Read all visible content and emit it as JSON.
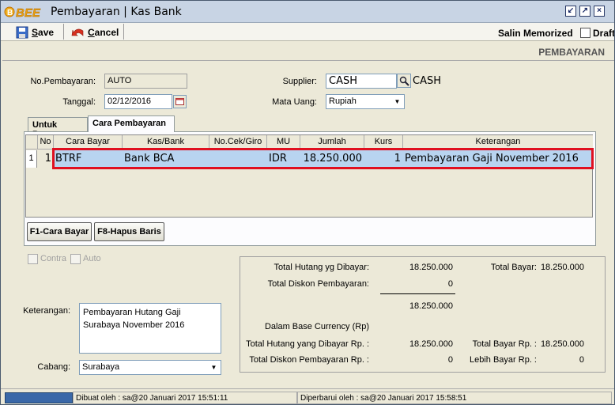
{
  "window": {
    "title": "Pembayaran | Kas Bank",
    "logo_text": "BEE"
  },
  "toolbar": {
    "save_label": "Save",
    "cancel_label": "Cancel",
    "memorized_label": "Salin Memorized",
    "draft_label": "Draft"
  },
  "header": {
    "heading": "PEMBAYARAN"
  },
  "form": {
    "no_pembayaran_label": "No.Pembayaran:",
    "no_pembayaran_value": "AUTO",
    "tanggal_label": "Tanggal:",
    "tanggal_value": "02/12/2016",
    "supplier_label": "Supplier:",
    "supplier_value": "CASH",
    "supplier_name": "CASH",
    "mata_uang_label": "Mata Uang:",
    "mata_uang_value": "Rupiah"
  },
  "tabs": [
    {
      "label": "Untuk Bayar"
    },
    {
      "label": "Cara Pembayaran"
    }
  ],
  "grid": {
    "columns": [
      "No",
      "Cara Bayar",
      "Kas/Bank",
      "No.Cek/Giro",
      "MU",
      "Jumlah",
      "Kurs",
      "Keterangan"
    ],
    "rows": [
      {
        "row_index": "1",
        "no": "1",
        "cara_bayar": "BTRF",
        "kas_bank": "Bank BCA",
        "no_cek": "",
        "mu": "IDR",
        "jumlah": "18.250.000",
        "kurs": "1",
        "keterangan": "Pembayaran Gaji November 2016"
      }
    ]
  },
  "buttons": {
    "cara_bayar": "F1-Cara Bayar",
    "hapus_baris": "F8-Hapus Baris"
  },
  "options": {
    "contra": "Contra",
    "auto": "Auto"
  },
  "notes": {
    "keterangan_label": "Keterangan:",
    "keterangan_line1": "Pembayaran Hutang Gaji",
    "keterangan_line2": "Surabaya November 2016",
    "cabang_label": "Cabang:",
    "cabang_value": "Surabaya"
  },
  "summary": {
    "total_hutang_label": "Total Hutang yg Dibayar:",
    "total_hutang_value": "18.250.000",
    "total_bayar_label": "Total Bayar:",
    "total_bayar_value": "18.250.000",
    "total_diskon_label": "Total Diskon Pembayaran:",
    "total_diskon_value": "0",
    "subtotal_value": "18.250.000",
    "base_currency_label": "Dalam Base Currency (Rp)",
    "total_hutang_rp_label": "Total Hutang yang Dibayar Rp. :",
    "total_hutang_rp_value": "18.250.000",
    "total_bayar_rp_label": "Total Bayar Rp. :",
    "total_bayar_rp_value": "18.250.000",
    "total_diskon_rp_label": "Total Diskon Pembayaran Rp. :",
    "total_diskon_rp_value": "0",
    "lebih_bayar_rp_label": "Lebih Bayar Rp. :",
    "lebih_bayar_rp_value": "0"
  },
  "status": {
    "dibuat": "Dibuat oleh : sa@20 Januari 2017  15:51:11",
    "diperbarui": "Diperbarui oleh : sa@20 Januari 2017  15:58:51"
  }
}
